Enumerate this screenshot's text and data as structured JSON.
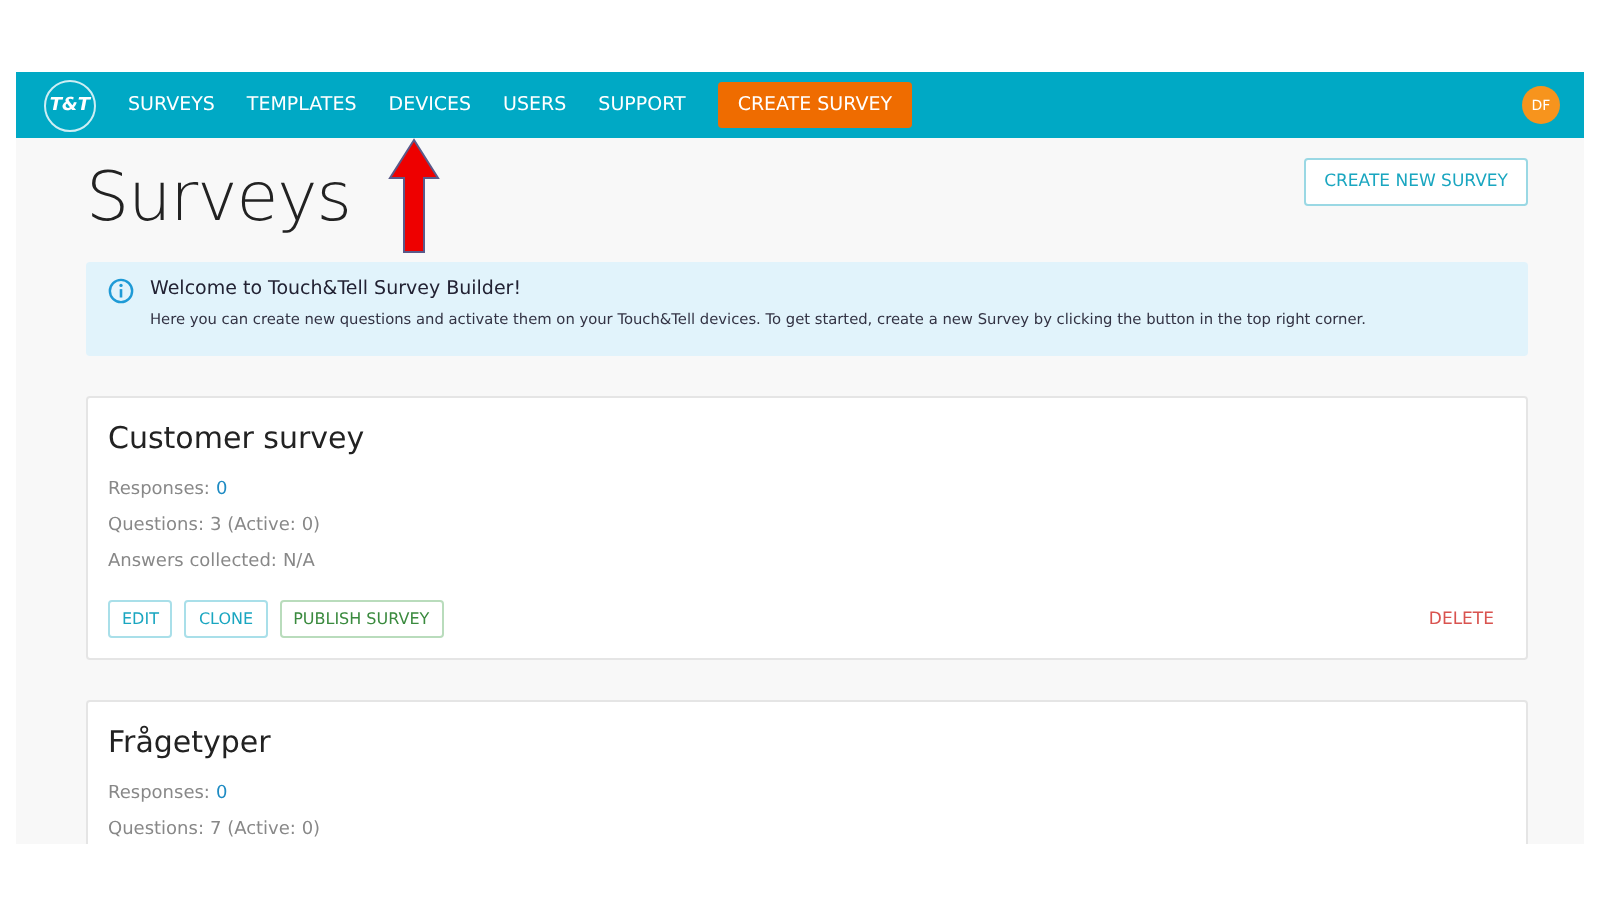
{
  "nav": {
    "logo": "T&T",
    "items": [
      {
        "label": "SURVEYS",
        "kind": "link"
      },
      {
        "label": "TEMPLATES",
        "kind": "link"
      },
      {
        "label": "DEVICES",
        "kind": "link"
      },
      {
        "label": "USERS",
        "kind": "link"
      },
      {
        "label": "SUPPORT",
        "kind": "link"
      },
      {
        "label": "CREATE SURVEY",
        "kind": "primary"
      }
    ],
    "avatar": "DF"
  },
  "page_title": "Surveys",
  "create_button": "CREATE NEW SURVEY",
  "alert": {
    "title": "Welcome to Touch&Tell Survey Builder!",
    "text": "Here you can create new questions and activate them on your Touch&Tell devices. To get started, create a new Survey by clicking the button in the top right corner."
  },
  "surveys": [
    {
      "name": "Customer survey",
      "stats": [
        {
          "label": "Responses:",
          "value": "0",
          "kind": "link"
        },
        {
          "label": "Questions:",
          "value": "3 (Active: 0)",
          "kind": "plain"
        },
        {
          "label": "Answers collected:",
          "value": "N/A",
          "kind": "plain"
        }
      ],
      "actions": [
        {
          "label": "EDIT",
          "kind": "info"
        },
        {
          "label": "CLONE",
          "kind": "info"
        },
        {
          "label": "PUBLISH SURVEY",
          "kind": "success"
        }
      ],
      "delete": "DELETE"
    },
    {
      "name": "Frågetyper",
      "stats": [
        {
          "label": "Responses:",
          "value": "0",
          "kind": "link"
        },
        {
          "label": "Questions:",
          "value": "7 (Active: 0)",
          "kind": "plain"
        }
      ]
    }
  ]
}
